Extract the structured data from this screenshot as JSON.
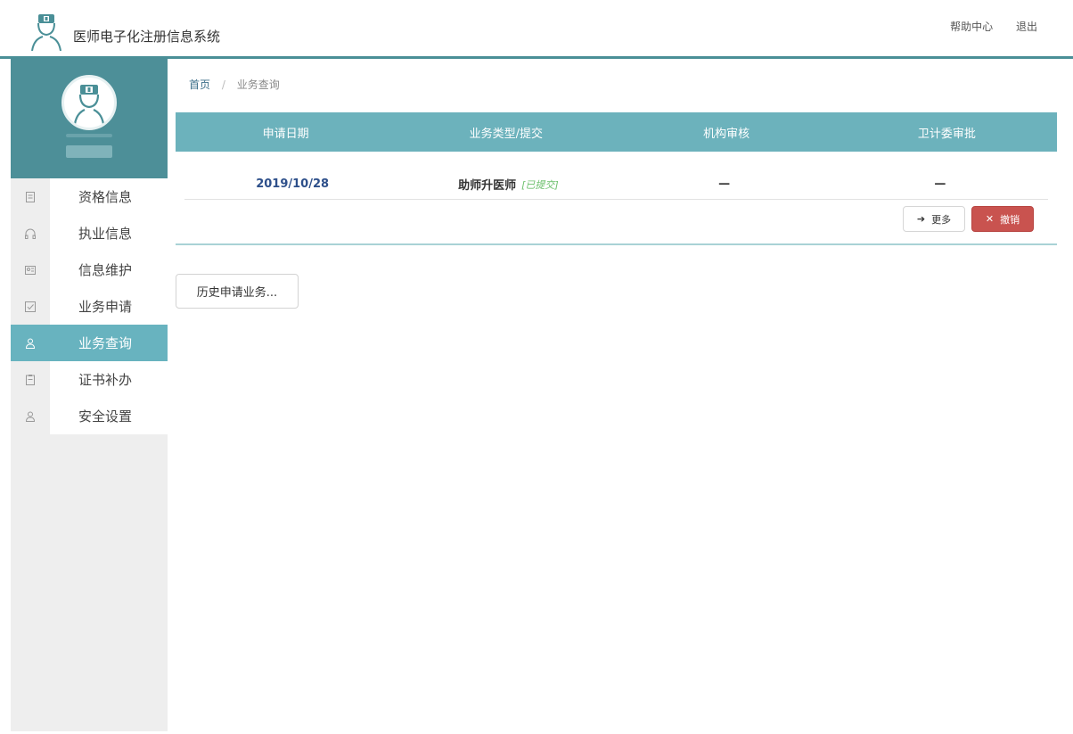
{
  "header": {
    "app_title": "医师电子化注册信息系统",
    "help_label": "帮助中心",
    "logout_label": "退出"
  },
  "sidebar": {
    "items": [
      {
        "label": "资格信息",
        "icon": "document-icon"
      },
      {
        "label": "执业信息",
        "icon": "headphones-icon"
      },
      {
        "label": "信息维护",
        "icon": "id-card-icon"
      },
      {
        "label": "业务申请",
        "icon": "checkbox-icon"
      },
      {
        "label": "业务查询",
        "icon": "user-icon",
        "active": true
      },
      {
        "label": "证书补办",
        "icon": "clipboard-icon"
      },
      {
        "label": "安全设置",
        "icon": "user-icon"
      }
    ]
  },
  "breadcrumb": {
    "home": "首页",
    "separator": "/",
    "current": "业务查询"
  },
  "table": {
    "headers": [
      "申请日期",
      "业务类型/提交",
      "机构审核",
      "卫计委审批"
    ],
    "rows": [
      {
        "date": "2019/10/28",
        "type": "助师升医师",
        "status": "[已提交]",
        "org_review": "—",
        "approval": "—"
      }
    ]
  },
  "actions": {
    "more_label": "更多",
    "cancel_label": "撤销",
    "history_label": "历史申请业务..."
  },
  "colors": {
    "accent": "#4d8f98",
    "table_header": "#6cb2bc",
    "active_menu": "#68b3bf",
    "danger": "#c9534f"
  }
}
